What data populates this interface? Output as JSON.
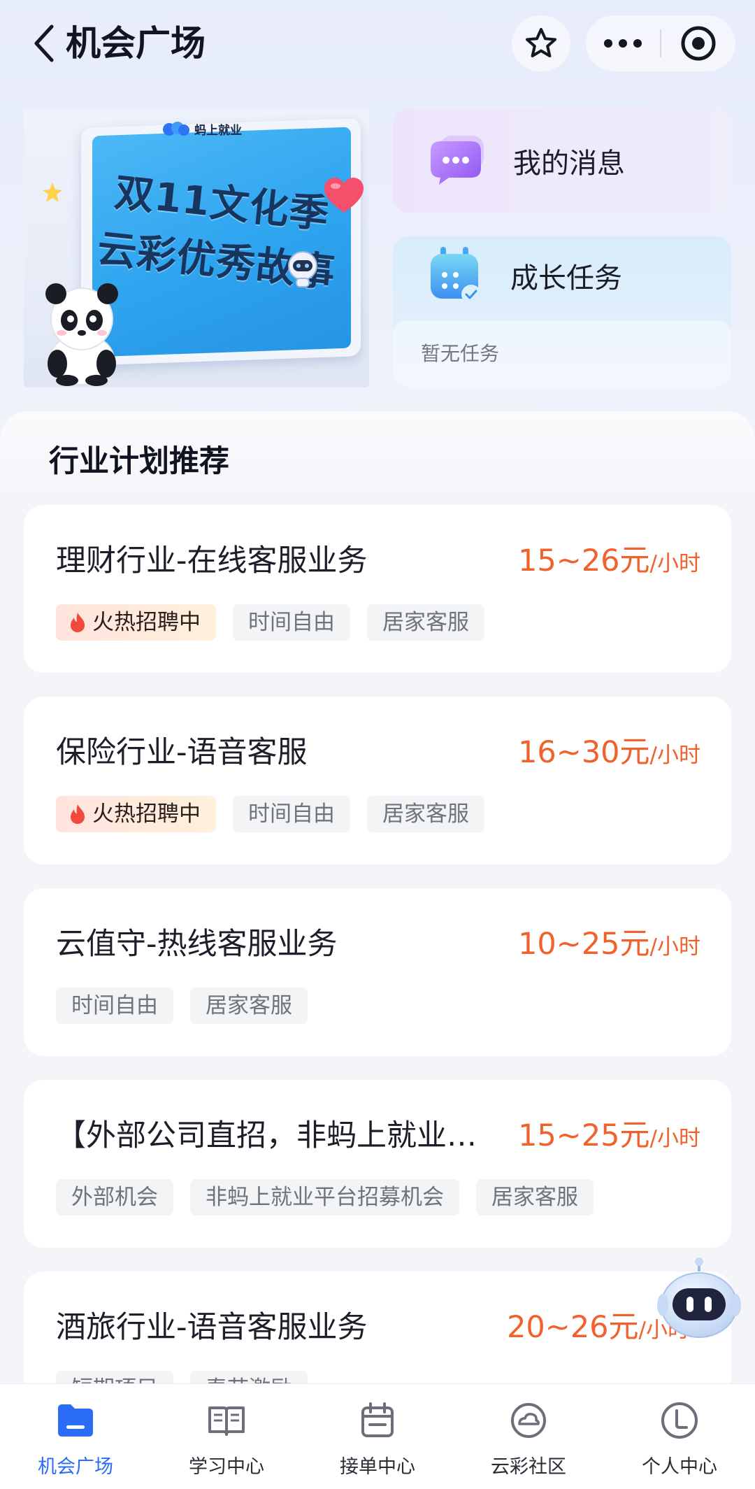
{
  "header": {
    "title": "机会广场",
    "back_icon": "chevron-left-icon",
    "favorite_icon": "star-icon",
    "more_icon": "more-dots-icon",
    "close_icon": "target-circle-icon"
  },
  "banner": {
    "brand": "蚂上就业",
    "headline_line1": "双11文化季",
    "headline_line2": "云彩优秀故事"
  },
  "messages_card": {
    "label": "我的消息",
    "icon": "chat-bubble-icon"
  },
  "tasks_card": {
    "label": "成长任务",
    "icon": "calendar-icon",
    "empty_text": "暂无任务"
  },
  "section": {
    "title": "行业计划推荐"
  },
  "jobs": [
    {
      "title": "理财行业-在线客服业务",
      "salary": "15~26元",
      "unit": "/小时",
      "tags": [
        "火热招聘中",
        "时间自由",
        "居家客服"
      ],
      "hot": true
    },
    {
      "title": "保险行业-语音客服",
      "salary": "16~30元",
      "unit": "/小时",
      "tags": [
        "火热招聘中",
        "时间自由",
        "居家客服"
      ],
      "hot": true
    },
    {
      "title": "云值守-热线客服业务",
      "salary": "10~25元",
      "unit": "/小时",
      "tags": [
        "时间自由",
        "居家客服"
      ],
      "hot": false
    },
    {
      "title": "【外部公司直招，非蚂上就业…",
      "salary": "15~25元",
      "unit": "/小时",
      "tags": [
        "外部机会",
        "非蚂上就业平台招募机会",
        "居家客服"
      ],
      "hot": false
    },
    {
      "title": "酒旅行业-语音客服业务",
      "salary": "20~26元",
      "unit": "/小时",
      "tags": [
        "短期项目",
        "春节激励"
      ],
      "hot": false
    }
  ],
  "tabbar": {
    "items": [
      {
        "label": "机会广场",
        "icon": "folder-icon",
        "active": true
      },
      {
        "label": "学习中心",
        "icon": "book-icon",
        "active": false
      },
      {
        "label": "接单中心",
        "icon": "clipboard-icon",
        "active": false
      },
      {
        "label": "云彩社区",
        "icon": "cloud-community-icon",
        "active": false
      },
      {
        "label": "个人中心",
        "icon": "profile-icon",
        "active": false
      }
    ]
  },
  "colors": {
    "accent": "#2b6cf6",
    "salary": "#f0612b",
    "hot_tag_bg": "#ffe4dd"
  }
}
